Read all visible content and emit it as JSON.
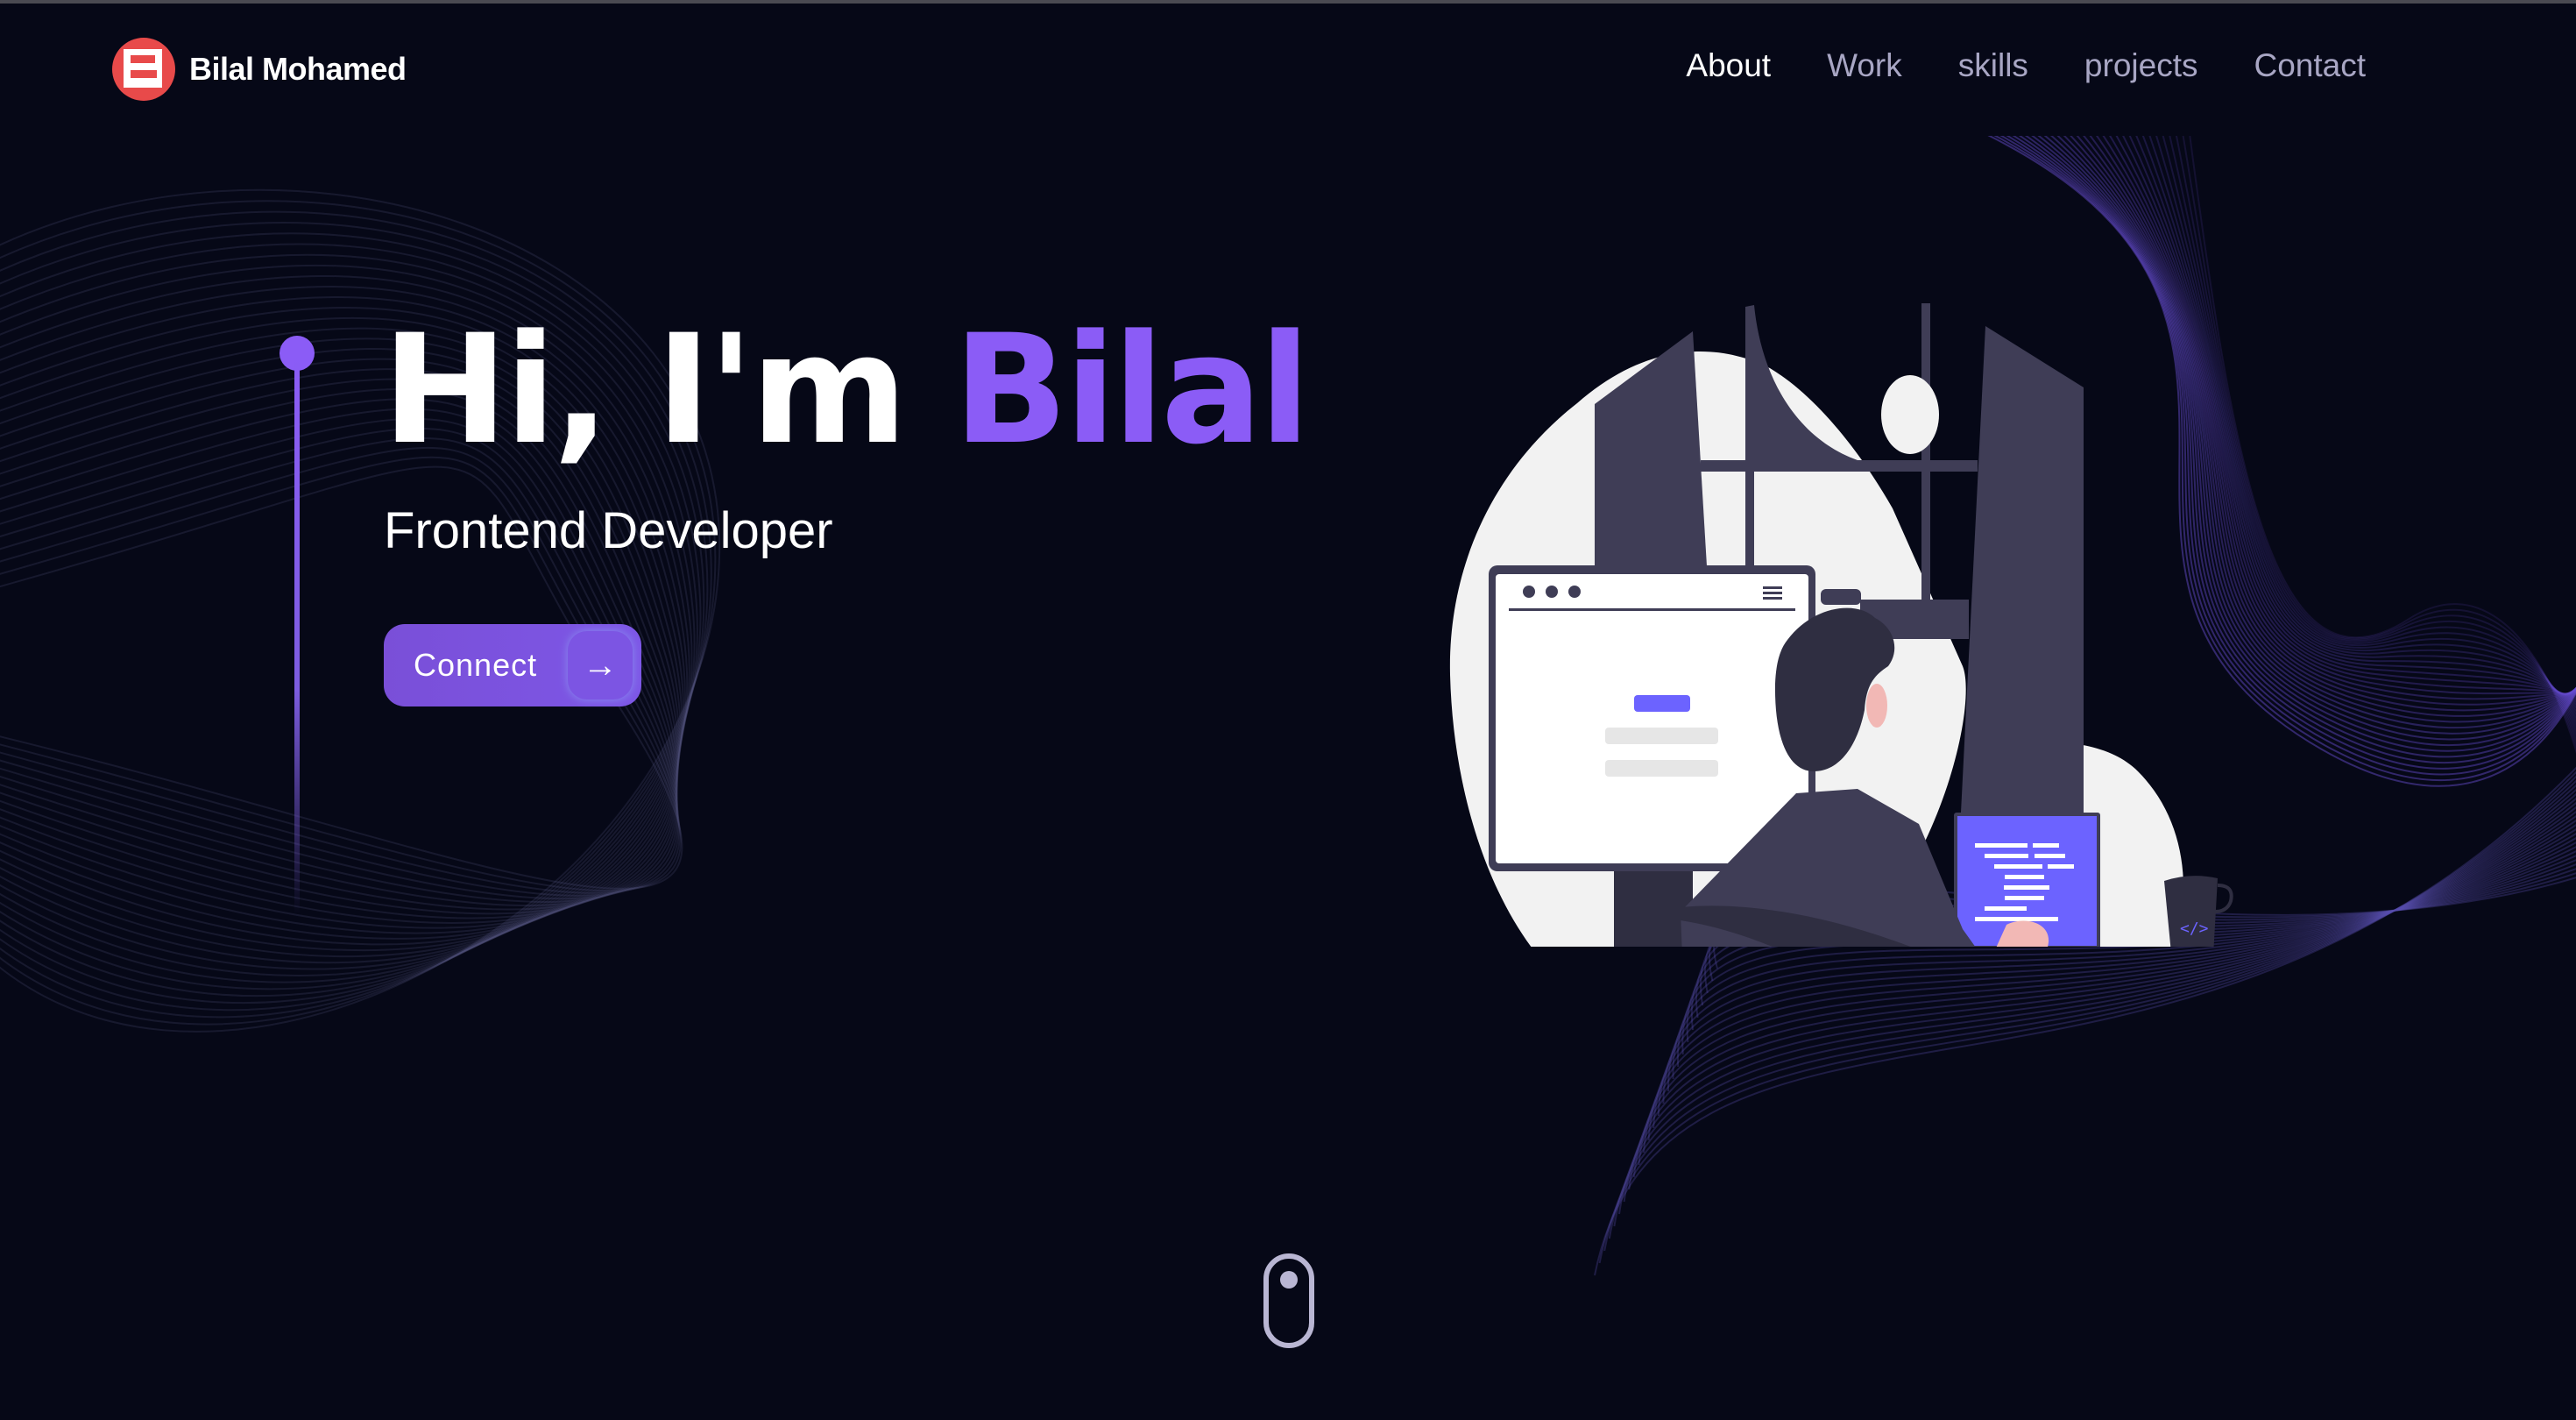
{
  "header": {
    "logo_name": "Bilal Mohamed",
    "nav": [
      {
        "label": "About",
        "active": true
      },
      {
        "label": "Work"
      },
      {
        "label": "skills"
      },
      {
        "label": "projects"
      },
      {
        "label": "Contact"
      }
    ]
  },
  "hero": {
    "greeting": "Hi, I'm ",
    "name": "Bilal",
    "subtitle": "Frontend Developer",
    "cta_label": "Connect",
    "cta_icon": "arrow-right-icon"
  },
  "colors": {
    "background": "#060817",
    "accent": "#8b5cf6",
    "logo": "#e84a4a",
    "nav_text": "#a8a6c4"
  }
}
